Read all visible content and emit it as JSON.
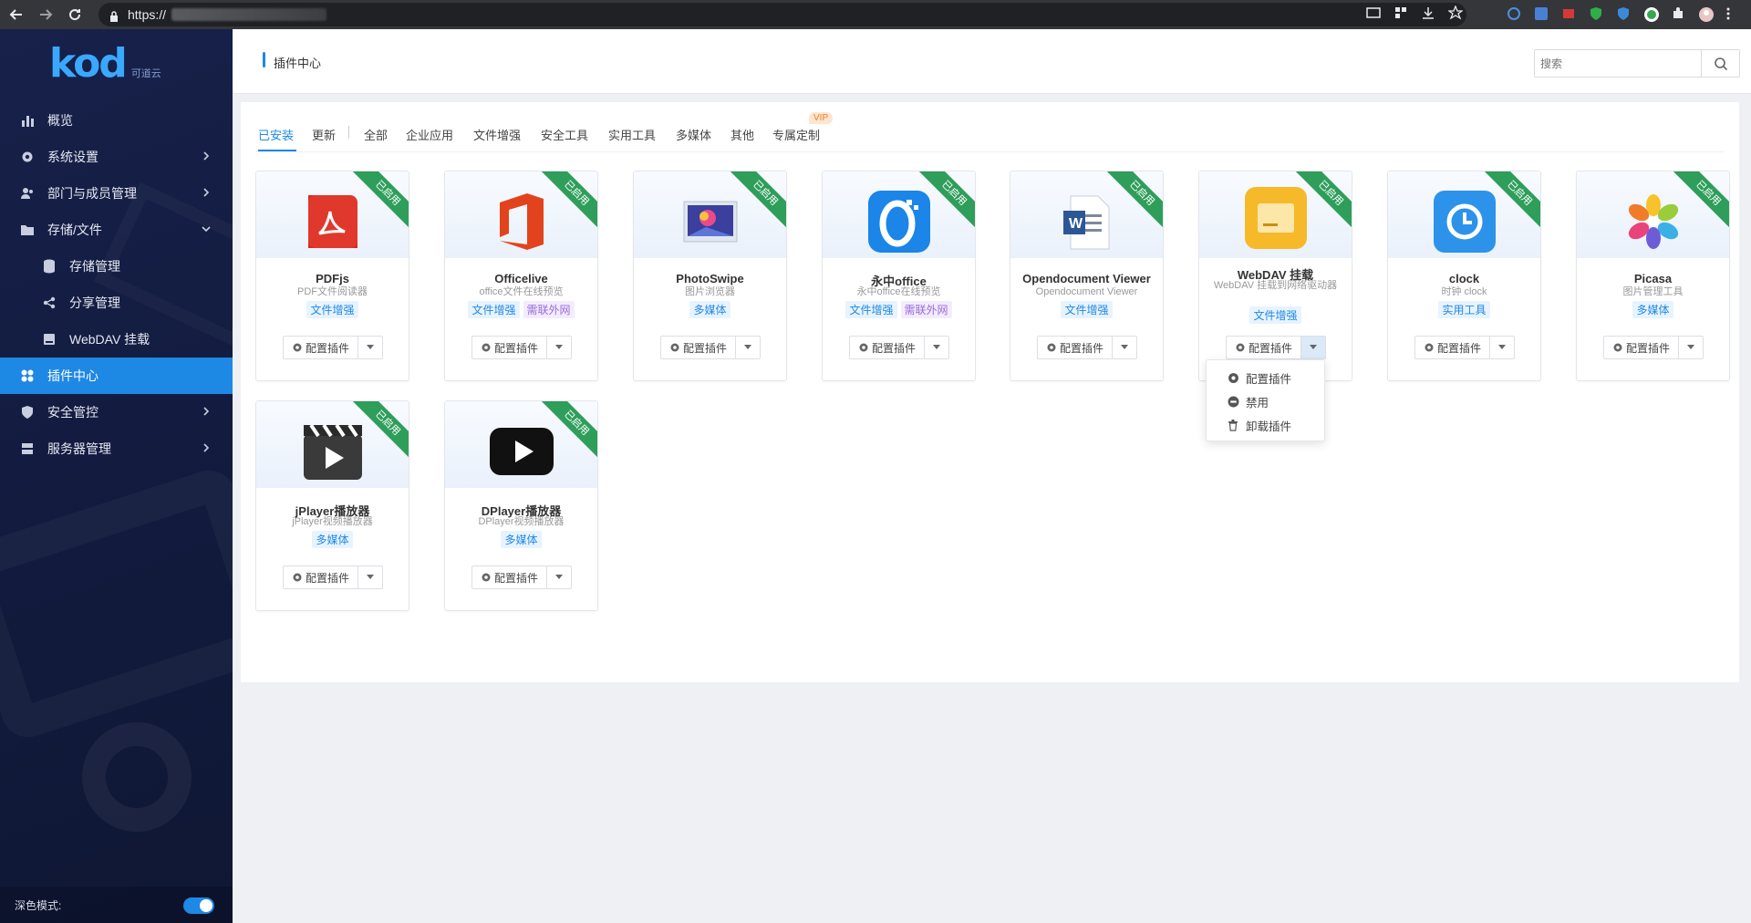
{
  "browser": {
    "url_prefix": "https://"
  },
  "sidebar": {
    "logo_mark": "kod",
    "logo_sub": "可道云",
    "items": [
      {
        "label": "概览",
        "icon": "bar-chart-icon"
      },
      {
        "label": "系统设置",
        "icon": "gear-icon"
      },
      {
        "label": "部门与成员管理",
        "icon": "users-icon"
      },
      {
        "label": "存储/文件",
        "icon": "folder-icon"
      },
      {
        "label": "存储管理",
        "icon": "database-icon"
      },
      {
        "label": "分享管理",
        "icon": "share-icon"
      },
      {
        "label": "WebDAV 挂载",
        "icon": "drive-icon"
      },
      {
        "label": "插件中心",
        "icon": "grid-icon"
      },
      {
        "label": "安全管控",
        "icon": "shield-icon"
      },
      {
        "label": "服务器管理",
        "icon": "server-icon"
      }
    ],
    "dark_mode_label": "深色模式:"
  },
  "header": {
    "title": "插件中心",
    "search_placeholder": "搜索"
  },
  "tabs": {
    "installed": "已安装",
    "update": "更新",
    "all": "全部",
    "enterprise": "企业应用",
    "file_enhance": "文件增强",
    "security": "安全工具",
    "utility": "实用工具",
    "media": "多媒体",
    "other": "其他",
    "custom": "专属定制",
    "vip": "VIP"
  },
  "ribbon_label": "已启用",
  "config_label": "配置插件",
  "plugins": [
    {
      "name": "PDFjs",
      "desc": "PDF文件阅读器",
      "tags": [
        "文件增强"
      ],
      "icon": "pdf-icon"
    },
    {
      "name": "Officelive",
      "desc": "office文件在线预览",
      "tags": [
        "文件增强",
        "需联外网"
      ],
      "icon": "office-icon"
    },
    {
      "name": "PhotoSwipe",
      "desc": "图片浏览器",
      "tags": [
        "多媒体"
      ],
      "icon": "photo-icon"
    },
    {
      "name": "永中office",
      "desc": "永中office在线预览",
      "tags": [
        "文件增强",
        "需联外网"
      ],
      "icon": "yozo-icon"
    },
    {
      "name": "Opendocument Viewer",
      "desc": "Opendocument Viewer",
      "tags": [
        "文件增强"
      ],
      "icon": "word-doc-icon"
    },
    {
      "name": "WebDAV 挂载",
      "desc": "WebDAV 挂载到网络驱动器",
      "tags": [
        "文件增强"
      ],
      "icon": "webdav-icon"
    },
    {
      "name": "clock",
      "desc": "时钟 clock",
      "tags": [
        "实用工具"
      ],
      "icon": "clock-icon"
    },
    {
      "name": "Picasa",
      "desc": "图片管理工具",
      "tags": [
        "多媒体"
      ],
      "icon": "picasa-icon"
    },
    {
      "name": "jPlayer播放器",
      "desc": "jPlayer视频播放器",
      "tags": [
        "多媒体"
      ],
      "icon": "clapper-icon"
    },
    {
      "name": "DPlayer播放器",
      "desc": "DPlayer视频播放器",
      "tags": [
        "多媒体"
      ],
      "icon": "play-icon"
    }
  ],
  "dropdown": {
    "configure": "配置插件",
    "disable": "禁用",
    "uninstall": "卸载插件"
  },
  "colors": {
    "accent": "#1e88e5",
    "sidebar_bg": "#131c40",
    "ribbon": "#2e9e5a",
    "vip": "#ef7e23"
  }
}
